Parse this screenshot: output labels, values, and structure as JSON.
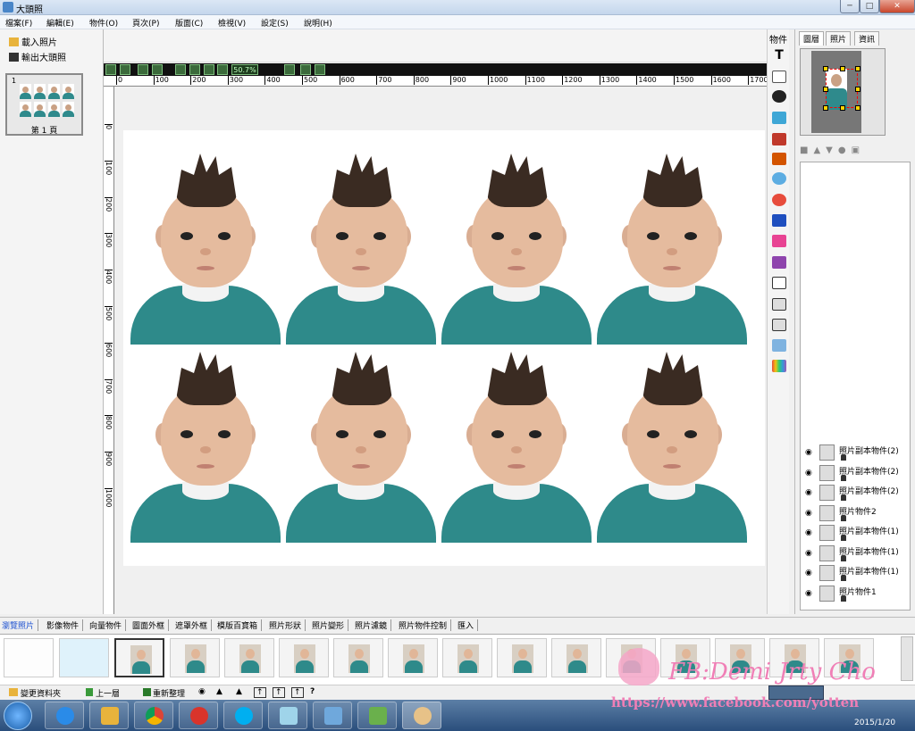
{
  "window": {
    "title": "大頭照",
    "min": "─",
    "max": "□",
    "close": "✕"
  },
  "menu": [
    "檔案(F)",
    "編輯(E)",
    "物件(O)",
    "頁次(P)",
    "版面(C)",
    "檢視(V)",
    "設定(S)",
    "說明(H)"
  ],
  "left_panel": {
    "load_label": "載入照片",
    "export_label": "輸出大頭照",
    "page_num": "1",
    "page_label": "第 1 頁"
  },
  "toolbar": {
    "zoom": "50.7%"
  },
  "ruler_h": [
    "0",
    "100",
    "200",
    "300",
    "400",
    "500",
    "600",
    "700",
    "800",
    "900",
    "1000",
    "1100",
    "1200",
    "1300",
    "1400",
    "1500",
    "1600",
    "1700"
  ],
  "ruler_v": [
    "0",
    "100",
    "200",
    "300",
    "400",
    "500",
    "600",
    "700",
    "800",
    "900",
    "1000"
  ],
  "object_panel": {
    "label": "物件",
    "text_tool": "T"
  },
  "right_panel": {
    "tabs": [
      "圖層",
      "照片",
      "資訊"
    ],
    "layers": [
      "照片副本物件(2)",
      "照片副本物件(2)",
      "照片副本物件(2)",
      "照片物件2",
      "照片副本物件(1)",
      "照片副本物件(1)",
      "照片副本物件(1)",
      "照片物件1"
    ]
  },
  "bottom_tabs": [
    "瀏覽照片",
    "影像物件",
    "向量物件",
    "圖面外框",
    "遮罩外框",
    "模版百寶箱",
    "照片形狀",
    "照片變形",
    "照片濾鏡",
    "照片物件控制",
    "匯入"
  ],
  "status_bar": {
    "change_folder": "變更資料夾",
    "up_level": "上一層",
    "refresh": "重新整理",
    "help": "?"
  },
  "watermark": {
    "line1": "FB:Demi Jrty Cho",
    "line2": "https://www.facebook.com/yotten"
  },
  "taskbar": {
    "date": "2015/1/20"
  },
  "colors": {
    "accent": "#2e8a8a",
    "watermark": "#f07fb6",
    "toolbar_bg": "#111111"
  }
}
